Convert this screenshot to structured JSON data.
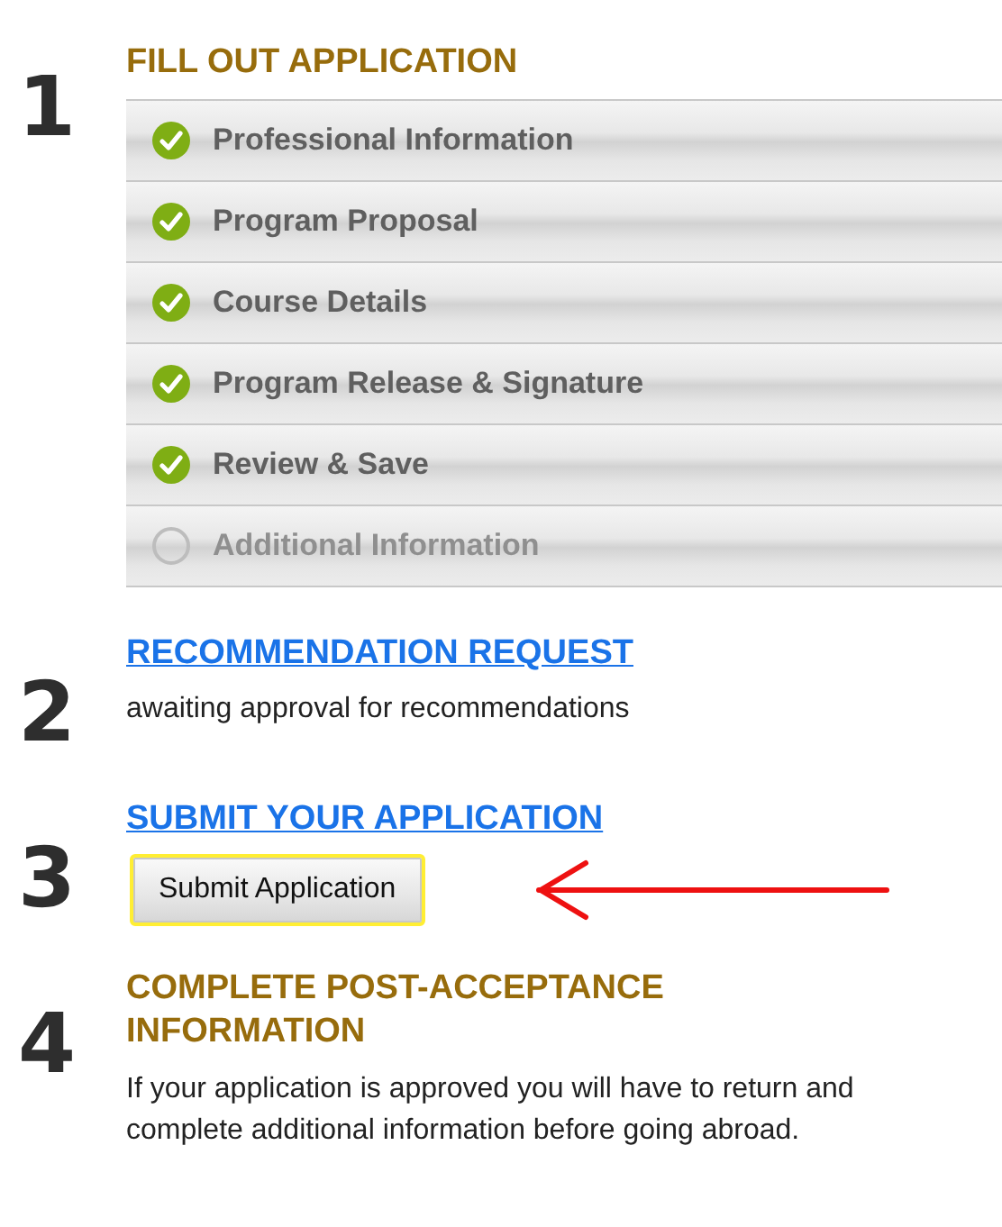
{
  "steps": [
    {
      "number": "1",
      "kind": "checklist",
      "title": {
        "text": "FILL OUT APPLICATION",
        "link": false
      },
      "items": [
        {
          "label": "Professional Information",
          "completed": true
        },
        {
          "label": "Program Proposal",
          "completed": true
        },
        {
          "label": "Course Details",
          "completed": true
        },
        {
          "label": "Program Release & Signature",
          "completed": true
        },
        {
          "label": "Review & Save",
          "completed": true
        },
        {
          "label": "Additional Information",
          "completed": false
        }
      ]
    },
    {
      "number": "2",
      "kind": "note",
      "title": {
        "text": "RECOMMENDATION REQUEST",
        "link": true
      },
      "note": "awaiting approval for recommendations"
    },
    {
      "number": "3",
      "kind": "button",
      "title": {
        "text": "SUBMIT YOUR APPLICATION",
        "link": true
      },
      "button": "Submit Application"
    },
    {
      "number": "4",
      "kind": "note",
      "title": {
        "text": "COMPLETE POST-ACCEPTANCE INFORMATION",
        "link": false
      },
      "note": "If your application is approved you will have to return and complete additional information before going abroad."
    }
  ]
}
